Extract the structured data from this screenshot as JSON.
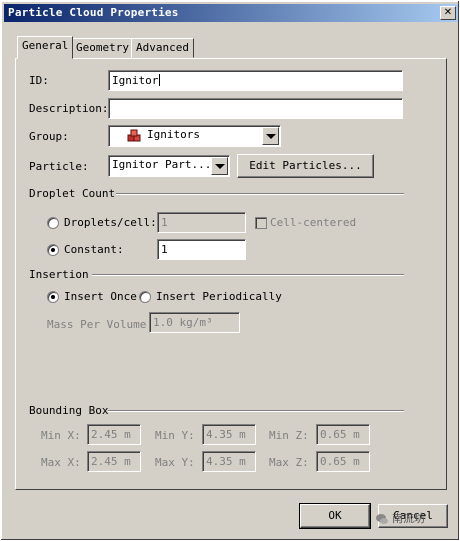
{
  "window": {
    "title": "Particle Cloud Properties",
    "close_glyph": "✕"
  },
  "tabs": [
    {
      "label": "General",
      "active": true
    },
    {
      "label": "Geometry",
      "active": false
    },
    {
      "label": "Advanced",
      "active": false
    }
  ],
  "fields": {
    "id": {
      "label": "ID:",
      "value": "Ignitor"
    },
    "description": {
      "label": "Description:",
      "value": ""
    },
    "group": {
      "label": "Group:",
      "value": "Ignitors",
      "icon": "cube-group-icon",
      "icon_color": "#c0302a"
    },
    "particle": {
      "label": "Particle:",
      "value": "Ignitor Part...",
      "edit_button": "Edit Particles..."
    }
  },
  "droplet_count": {
    "heading": "Droplet Count",
    "droplets_per_cell": {
      "label": "Droplets/cell:",
      "value": "1",
      "selected": false,
      "enabled": false
    },
    "cell_centered": {
      "label": "Cell-centered",
      "checked": false,
      "enabled": false
    },
    "constant": {
      "label": "Constant:",
      "value": "1",
      "selected": true
    }
  },
  "insertion": {
    "heading": "Insertion",
    "insert_once": {
      "label": "Insert Once",
      "selected": true
    },
    "insert_periodically": {
      "label": "Insert Periodically",
      "selected": false
    },
    "mass_per_volume": {
      "label": "Mass Per Volume:",
      "value": "1.0 kg/m³",
      "enabled": false
    }
  },
  "bounding_box": {
    "heading": "Bounding Box",
    "min_x": {
      "label": "Min X:",
      "value": "2.45 m"
    },
    "min_y": {
      "label": "Min Y:",
      "value": "4.35 m"
    },
    "min_z": {
      "label": "Min Z:",
      "value": "0.65 m"
    },
    "max_x": {
      "label": "Max X:",
      "value": "2.45 m"
    },
    "max_y": {
      "label": "Max Y:",
      "value": "4.35 m"
    },
    "max_z": {
      "label": "Max Z:",
      "value": "0.65 m"
    }
  },
  "buttons": {
    "ok": "OK",
    "cancel": "Cancel"
  },
  "watermark": {
    "text": "南流坊"
  },
  "colors": {
    "titlebar_start": "#0a246a",
    "titlebar_end": "#a6caf0",
    "face": "#d4d0c8"
  }
}
